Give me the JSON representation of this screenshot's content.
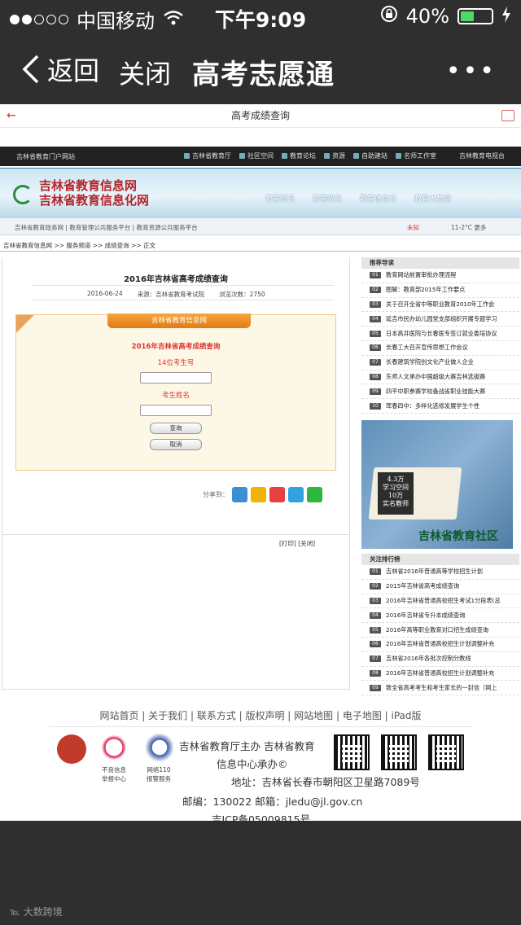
{
  "status": {
    "carrier": "中国移动",
    "time": "下午9:09",
    "battery": "40%",
    "battery_level": 0.4
  },
  "nav": {
    "back": "返回",
    "close": "关闭",
    "title": "高考志愿通",
    "more": "•••"
  },
  "webview_title": "高考成绩查询",
  "site": {
    "portal": "吉林省教育门户网站",
    "top_links": [
      "吉林省教育厅",
      "社区空间",
      "教育论坛",
      "资源",
      "自助建站",
      "名师工作室"
    ],
    "tv": "吉林教育电视台",
    "brand_line1": "吉林省教育信息网",
    "brand_line2": "吉林省教育信息化网",
    "menu": [
      "教育资讯",
      "教育政务",
      "教育信息化",
      "教育大数据"
    ],
    "sublinks": "吉林省教育政务网 | 教育管理公共服务平台 | 教育资源公共服务平台",
    "weather": "未知",
    "temp": "11-2°C 更多",
    "breadcrumb": "吉林省教育信息网 >> 服务频道 >> 成绩查询 >> 正文"
  },
  "article": {
    "title": "2016年吉林省高考成绩查询",
    "date": "2016-06-24",
    "source": "来源：吉林省教育考试院",
    "views": "浏览次数：2750",
    "form_tab": "吉林省教育信息网",
    "form_heading": "2016年吉林省高考成绩查询",
    "id_label": "14位考生号",
    "name_label": "考生姓名",
    "query_btn": "查询",
    "cancel_btn": "取消",
    "share_label": "分享到：",
    "print": "[打印]  [关闭]"
  },
  "sidebar": {
    "recommend_title": "推荐导读",
    "recommend": [
      "教育网站前置审批办理流程",
      "图解：教育部2015年工作要点",
      "关于召开全省中等职业教育2010年工作会",
      "延吉市民办幼儿园党支部组织开展专题学习",
      "日本高井医院与长春医专签订就业委培协议",
      "长春工大召开宣传思想工作会议",
      "长春建筑学院创文化产业做人企业",
      "东师人文承办中国超级大赛吉林选拔赛",
      "四平中职参赛学校备战省职业技能大赛",
      "珲春四中：多样化选修发展学生个性"
    ],
    "ad_big": "4.3万",
    "ad_sub1": "学习空间",
    "ad_big2": "10万",
    "ad_sub2": "实名教师",
    "ad_title": "吉林省教育社区",
    "rank_title": "关注排行榜",
    "rank": [
      "吉林省2016年普通高等学校招生计划",
      "2015年吉林省高考成绩查询",
      "2016年吉林省普通高校招生考试1分段表(总",
      "2016年吉林省专升本成绩查询",
      "2016年高等职业教育对口招生成绩查询",
      "2016年吉林省普通高校招生计划调整补充",
      "吉林省2016年各批次控制分数线",
      "2016年吉林省普通高校招生计划调整补充",
      "致全省高考考生和考生家长的一封信（网上",
      "2016年吉林省高考成绩查询"
    ]
  },
  "footer": {
    "nav": "网站首页 | 关于我们 | 联系方式 | 版权声明 | 网站地图 | 电子地图 | iPad版",
    "badge1": "",
    "badge2": "不良信息\n举报中心",
    "badge3": "网络110\n报警服务",
    "host": "吉林省教育厅主办  吉林省教育",
    "host2": "信息中心承办©",
    "address": "地址：吉林省长春市朝阳区卫星路7089号",
    "postcode": "邮编：130022 邮箱：jledu@jl.gov.cn",
    "icp": "吉ICP备05009815号"
  },
  "watermark": "大数跨境"
}
